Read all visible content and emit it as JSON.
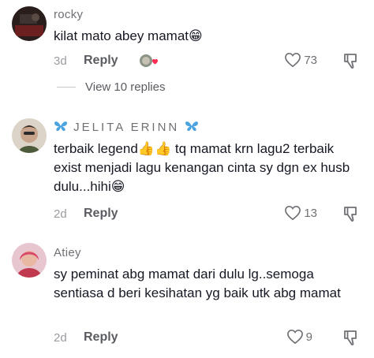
{
  "comments": [
    {
      "username": "rocky",
      "text": "kilat mato abey mamat",
      "emoji": "😁",
      "age": "3d",
      "reply_label": "Reply",
      "likes": "73",
      "view_replies": "View 10 replies"
    },
    {
      "username": "JELITA ERINN",
      "text_part1": "terbaik legend",
      "emoji_thumbs": "👍👍",
      "text_part2": " tq mamat krn lagu2 terbaik exist menjadi lagu kenangan cinta sy dgn ex husb dulu...hihi",
      "emoji": "😁",
      "age": "2d",
      "reply_label": "Reply",
      "likes": "13"
    },
    {
      "username": "Atiey",
      "text": "sy peminat abg mamat dari dulu lg..semoga sentiasa d beri kesihatan yg baik utk abg mamat",
      "age": "2d",
      "reply_label": "Reply",
      "likes": "9"
    }
  ],
  "colors": {
    "text": "#161823",
    "muted": "#6f7075",
    "butterfly": "#4aa3df"
  }
}
